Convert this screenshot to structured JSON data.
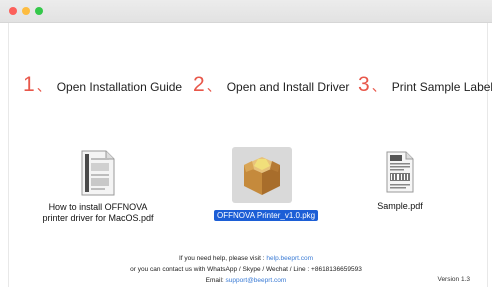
{
  "window": {
    "traffic_lights": {
      "close": "#fc605b",
      "minimize": "#fdbc40",
      "maximize": "#34c84a"
    }
  },
  "steps": [
    {
      "number": "1",
      "separator": "、",
      "label": "Open Installation Guide"
    },
    {
      "number": "2",
      "separator": "、",
      "label": "Open and Install Driver"
    },
    {
      "number": "3",
      "separator": "、",
      "label": "Print Sample Label"
    }
  ],
  "files": {
    "guide": {
      "line1": "How to install OFFNOVA",
      "line2": "printer driver for MacOS.pdf",
      "icon": "pdf-document-icon"
    },
    "package": {
      "label": "OFFNOVA Printer_v1.0.pkg",
      "icon": "package-box-icon",
      "selected": true
    },
    "sample": {
      "label": "Sample.pdf",
      "icon": "label-document-icon"
    }
  },
  "help": {
    "line1_text": "If you need help,  please visit :",
    "line1_link": "help.beeprt.com",
    "line2": "or you can contact us with WhatsApp / Skype / Wechat / Line : +8618136659593",
    "line3_text": "Email:",
    "line3_link": "support@beeprt.com"
  },
  "version": "Version 1.3",
  "colors": {
    "step_number": "#e8574a",
    "link": "#3a7bd5",
    "selection": "#1c5ed6"
  }
}
